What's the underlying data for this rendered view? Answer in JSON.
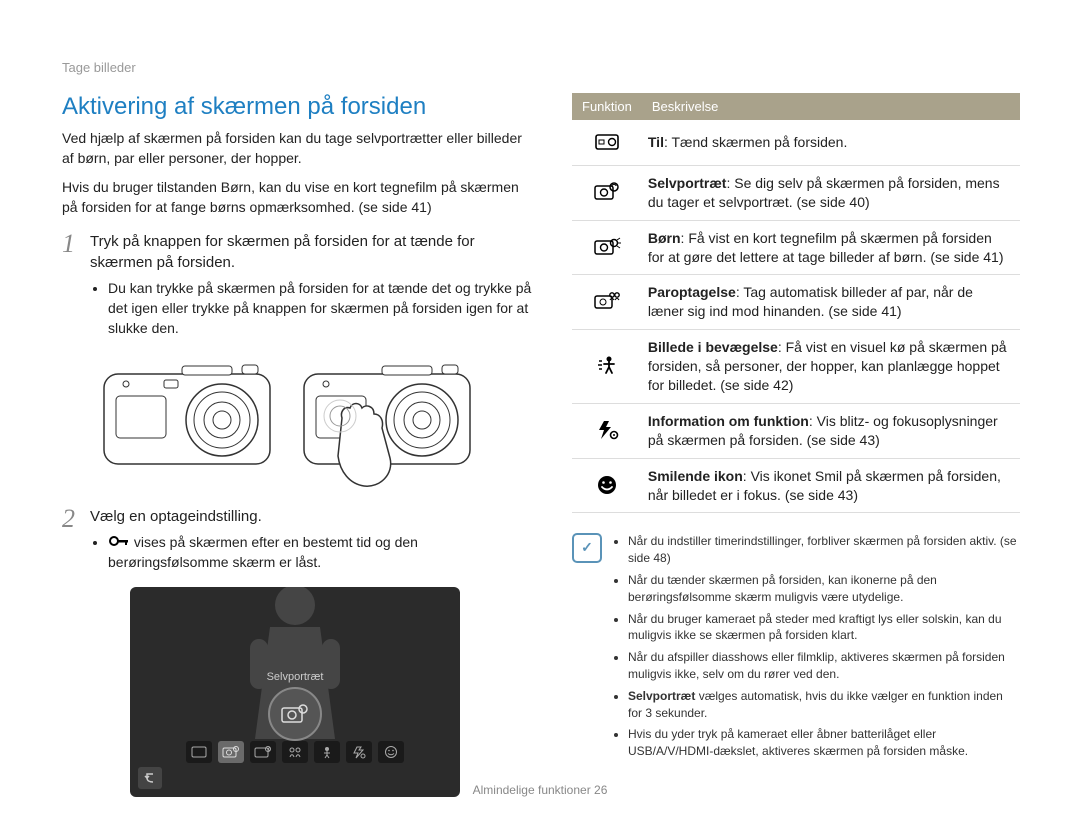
{
  "section_label": "Tage billeder",
  "title": "Aktivering af skærmen på forsiden",
  "intro_p1": "Ved hjælp af skærmen på forsiden kan du tage selvportrætter eller billeder af børn, par eller personer, der hopper.",
  "intro_p2": "Hvis du bruger tilstanden Børn, kan du vise en kort tegnefilm på skærmen på forsiden for at fange børns opmærksomhed. (se side 41)",
  "step1_title": "Tryk på knappen for skærmen på forsiden for at tænde for skærmen på forsiden.",
  "step1_bullet": "Du kan trykke på skærmen på forsiden for at tænde det og trykke på det igen eller trykke på knappen for skærmen på forsiden igen for at slukke den.",
  "step2_title": "Vælg en optageindstilling.",
  "step2_bullet_before": "",
  "step2_bullet_after": " vises på skærmen efter en bestemt tid og den berøringsfølsomme skærm er låst.",
  "lcd_label": "Selvportræt",
  "table_headers": {
    "col1": "Funktion",
    "col2": "Beskrivelse"
  },
  "rows": [
    {
      "icon": "screen-icon",
      "bold": "Til",
      "text": ": Tænd skærmen på forsiden."
    },
    {
      "icon": "selfportrait-icon",
      "bold": "Selvportræt",
      "text": ": Se dig selv på skærmen på forsiden, mens du tager et selvportræt. (se side 40)"
    },
    {
      "icon": "children-icon",
      "bold": "Børn",
      "text": ": Få vist en kort tegnefilm på skærmen på forsiden for at gøre det lettere at tage billeder af børn. (se side 41)"
    },
    {
      "icon": "couple-icon",
      "bold": "Paroptagelse",
      "text": ": Tag automatisk billeder af par, når de læner sig ind mod hinanden. (se side 41)"
    },
    {
      "icon": "jump-icon",
      "bold": "Billede i bevægelse",
      "text": ": Få vist en visuel kø på skærmen på forsiden, så personer, der hopper, kan planlægge hoppet for billedet. (se side 42)"
    },
    {
      "icon": "info-icon",
      "bold": "Information om funktion",
      "text": ": Vis blitz- og fokusoplysninger på skærmen på forsiden. (se side 43)"
    },
    {
      "icon": "smile-icon",
      "bold": "Smilende ikon",
      "text": ": Vis ikonet Smil på skærmen på forsiden, når billedet er i fokus. (se side 43)"
    }
  ],
  "notes": [
    "Når du indstiller timerindstillinger, forbliver skærmen på forsiden aktiv. (se side 48)",
    "Når du tænder skærmen på forsiden, kan ikonerne på den berøringsfølsomme skærm muligvis være utydelige.",
    "Når du bruger kameraet på steder med kraftigt lys eller solskin, kan du muligvis ikke se skærmen på forsiden klart.",
    "Når du afspiller diasshows eller filmklip, aktiveres skærmen på forsiden muligvis ikke, selv om du rører ved den.",
    "Selvportræt vælges automatisk, hvis du ikke vælger en funktion inden for 3 sekunder.",
    "Hvis du yder tryk på kameraet eller åbner batterilåget eller USB/A/V/HDMI-dækslet, aktiveres skærmen på forsiden måske."
  ],
  "note_bold_index": 4,
  "note_bold_word": "Selvportræt",
  "footer": "Almindelige funktioner  26"
}
